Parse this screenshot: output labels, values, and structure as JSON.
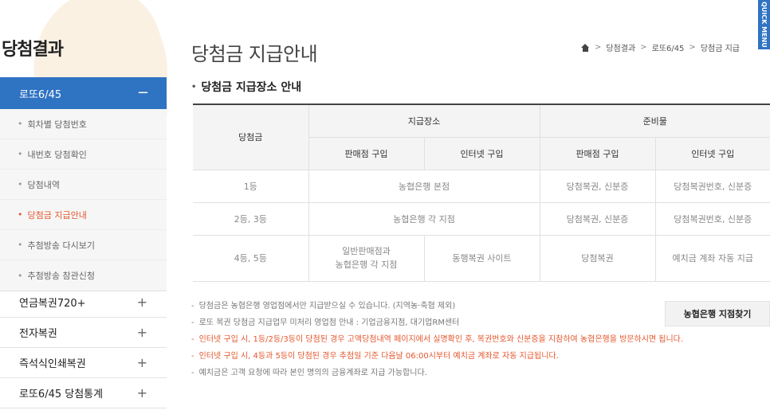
{
  "sidebar": {
    "title": "당첨결과",
    "active_menu": {
      "label": "로또6/45",
      "toggle": "−"
    },
    "sub_items": [
      {
        "label": "회차별 당첨번호",
        "active": false
      },
      {
        "label": "내번호 당첨확인",
        "active": false
      },
      {
        "label": "당첨내역",
        "active": false
      },
      {
        "label": "당첨금 지급안내",
        "active": true
      },
      {
        "label": "추첨방송 다시보기",
        "active": false
      },
      {
        "label": "추첨방송 참관신청",
        "active": false
      }
    ],
    "menu_items": [
      {
        "label": "연금복권720+",
        "toggle": "+"
      },
      {
        "label": "전자복권",
        "toggle": "+"
      },
      {
        "label": "즉석식인쇄복권",
        "toggle": "+"
      },
      {
        "label": "로또6/45 당첨통계",
        "toggle": "+"
      }
    ]
  },
  "header": {
    "title": "당첨금 지급안내",
    "breadcrumb": [
      "당첨결과",
      "로또6/45",
      "당첨금 지급"
    ],
    "quick_menu": "QUICK MENU"
  },
  "section": {
    "title": "당첨금 지급장소 안내"
  },
  "table": {
    "head_prize": "당첨금",
    "head_place": "지급장소",
    "head_prep": "준비물",
    "sub_store": "판매점 구입",
    "sub_internet": "인터넷 구입",
    "sub_store2": "판매점 구입",
    "sub_internet2": "인터넷 구입",
    "rows": [
      {
        "prize": "1등",
        "place": "농협은행 본점",
        "store_prep": "당첨복권, 신분증",
        "internet_prep": "당첨복권번호, 신분증"
      },
      {
        "prize": "2등, 3등",
        "place": "농협은행 각 지점",
        "store_prep": "당첨복권, 신분증",
        "internet_prep": "당첨복권번호, 신분증"
      },
      {
        "prize": "4등, 5등",
        "place_store_1": "일반판매점과",
        "place_store_2": "농협은행 각 지점",
        "place_internet": "동행복권 사이트",
        "store_prep": "당첨복권",
        "internet_prep": "예치금 계좌 자동 지급"
      }
    ]
  },
  "notes": [
    {
      "text": "당첨금은 농협은행 영업점에서만 지급받으실 수 있습니다. (지역농·축협 제외)",
      "highlight": false
    },
    {
      "text": "로또 복권 당첨금 지급업무 미처리 영업점 안내 : 기업금융지점, 대기업RM센터",
      "highlight": false
    },
    {
      "text": "인터넷 구입 시, 1등/2등/3등이 당첨된 경우 고액당첨내역 페이지에서 실명확인 후, 복권번호와 신분증을 지참하여 농협은행을 방문하시면 됩니다.",
      "highlight": true
    },
    {
      "text": "인터넷 구입 시, 4등과 5등이 당첨된 경우 추첨일 기준 다음날 06:00시부터 예치금 계좌로 자동 지급됩니다.",
      "highlight": true
    },
    {
      "text": "예치금은 고객 요청에 따라 본인 명의의 금융계좌로 지급 가능합니다.",
      "highlight": false
    }
  ],
  "branch_button": "농협은행 지점찾기",
  "colors": {
    "accent": "#2f73c3",
    "highlight": "#e4572e"
  }
}
